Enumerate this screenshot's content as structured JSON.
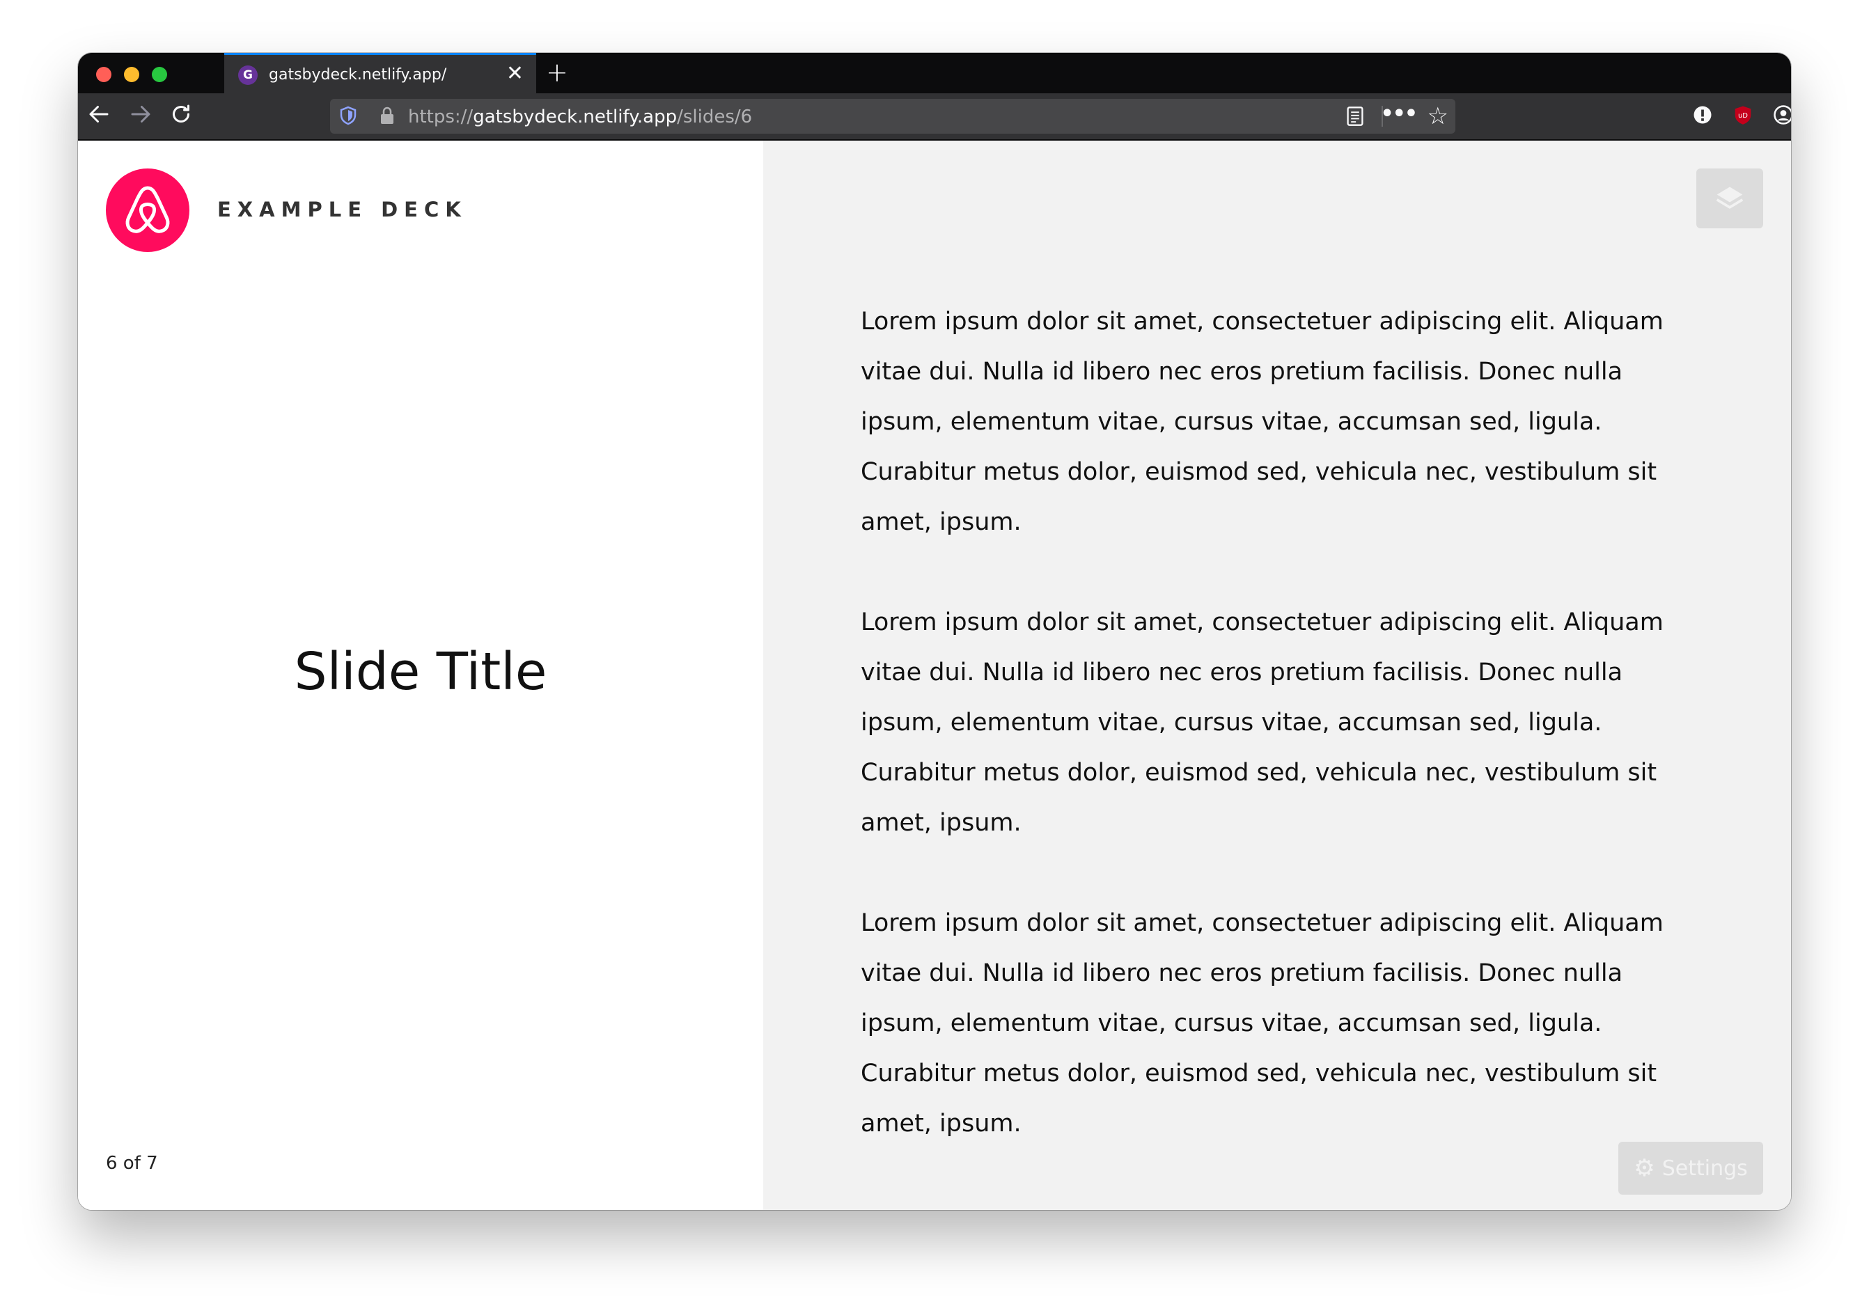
{
  "browser": {
    "tab": {
      "title": "gatsbydeck.netlify.app/",
      "favicon": "gatsby-icon",
      "close_label": "✕"
    },
    "new_tab_label": "+",
    "url": {
      "prefix": "https://",
      "host": "gatsbydeck.netlify.app",
      "path": "/slides/6"
    },
    "accent": "#0a84ff"
  },
  "slide": {
    "brand": {
      "logo": "airbnb-logo",
      "color": "#ff0b5d"
    },
    "deck_name": "EXAMPLE DECK",
    "title": "Slide Title",
    "counter": "6 of 7",
    "paragraphs": [
      "Lorem ipsum dolor sit amet, consectetuer adipiscing elit. Aliquam vitae dui. Nulla id libero nec eros pretium facilisis. Donec nulla ipsum, elementum vitae, cursus vitae, accumsan sed, ligula. Curabitur metus dolor, euismod sed, vehicula nec, vestibulum sit amet, ipsum.",
      "Lorem ipsum dolor sit amet, consectetuer adipiscing elit. Aliquam vitae dui. Nulla id libero nec eros pretium facilisis. Donec nulla ipsum, elementum vitae, cursus vitae, accumsan sed, ligula. Curabitur metus dolor, euismod sed, vehicula nec, vestibulum sit amet, ipsum.",
      "Lorem ipsum dolor sit amet, consectetuer adipiscing elit. Aliquam vitae dui. Nulla id libero nec eros pretium facilisis. Donec nulla ipsum, elementum vitae, cursus vitae, accumsan sed, ligula. Curabitur metus dolor, euismod sed, vehicula nec, vestibulum sit amet, ipsum."
    ],
    "settings_label": "Settings"
  }
}
